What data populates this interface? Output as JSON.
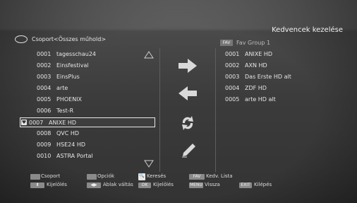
{
  "header": {
    "title": "Kedvencek kezelése"
  },
  "left_panel": {
    "group_label": "Csoport<Összes műhold>",
    "channels": [
      {
        "num": "0001",
        "name": "tagesschau24"
      },
      {
        "num": "0002",
        "name": "Einsfestival"
      },
      {
        "num": "0003",
        "name": "EinsPlus"
      },
      {
        "num": "0004",
        "name": "arte"
      },
      {
        "num": "0005",
        "name": "PHOENIX"
      },
      {
        "num": "0006",
        "name": "Test-R"
      },
      {
        "num": "0007",
        "name": "ANIXE HD"
      },
      {
        "num": "0008",
        "name": "QVC HD"
      },
      {
        "num": "0009",
        "name": "HSE24 HD"
      },
      {
        "num": "0010",
        "name": "ASTRA Portal"
      }
    ],
    "selected_index": 6
  },
  "right_panel": {
    "fav_badge": "FAV",
    "group_name": "Fav Group 1",
    "channels": [
      {
        "num": "0001",
        "name": "ANIXE HD"
      },
      {
        "num": "0002",
        "name": "AXN HD"
      },
      {
        "num": "0003",
        "name": "Das Erste HD alt"
      },
      {
        "num": "0004",
        "name": "ZDF HD"
      },
      {
        "num": "0005",
        "name": "arte HD alt"
      }
    ]
  },
  "actions": {
    "icons": [
      "arrow-right-icon",
      "arrow-left-icon",
      "swap-icon",
      "rename-icon"
    ]
  },
  "footer": {
    "row1": [
      {
        "key": "",
        "label": "Csoport",
        "color": "#8a8a8a"
      },
      {
        "key": "",
        "label": "Opciók",
        "color": "#8a8a8a"
      },
      {
        "key": "🔍",
        "label": "Keresés",
        "color": "#e8e8e8"
      },
      {
        "key": "FAV",
        "label": "Kedv. Lista",
        "color": "#8a8a8a"
      }
    ],
    "row2": [
      {
        "key": "⬍",
        "label": "Kijelölés"
      },
      {
        "key": "◀▶",
        "label": "Ablak váltás"
      },
      {
        "key": "OK",
        "label": "Kijelölés"
      },
      {
        "key": "MENU",
        "label": "Vissza"
      },
      {
        "key": "EXIT",
        "label": "Kilépés"
      }
    ]
  }
}
